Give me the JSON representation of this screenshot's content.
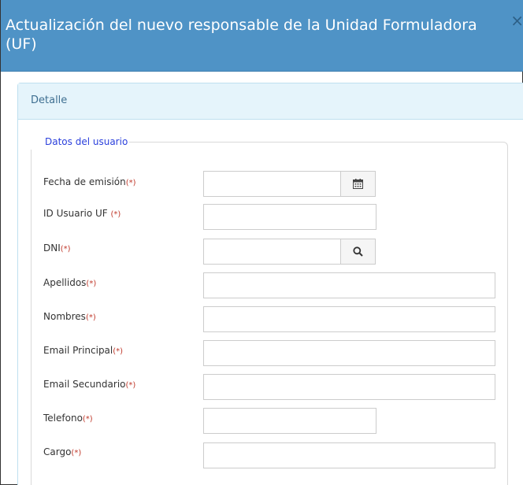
{
  "modal": {
    "title": "Actualización del nuevo responsable de la Unidad Formuladora (UF)",
    "close_icon": "×"
  },
  "panel": {
    "heading": "Detalle"
  },
  "fieldset": {
    "legend": "Datos del usuario"
  },
  "fields": {
    "fecha_emision": {
      "label": "Fecha de emisión",
      "required": "(*)",
      "value": "",
      "icon": "calendar-icon"
    },
    "id_usuario": {
      "label": "ID Usuario UF ",
      "required": "(*)",
      "value": ""
    },
    "dni": {
      "label": "DNI",
      "required": "(*)",
      "value": "",
      "icon": "search-icon"
    },
    "apellidos": {
      "label": "Apellidos",
      "required": "(*)",
      "value": ""
    },
    "nombres": {
      "label": "Nombres",
      "required": "(*)",
      "value": ""
    },
    "email_principal": {
      "label": "Email Principal",
      "required": "(*)",
      "value": ""
    },
    "email_secundario": {
      "label": "Email Secundario",
      "required": "(*)",
      "value": ""
    },
    "telefono": {
      "label": "Telefono",
      "required": "(*)",
      "value": ""
    },
    "cargo": {
      "label": "Cargo",
      "required": "(*)",
      "value": ""
    }
  },
  "colors": {
    "header": "#4f93c6",
    "panel_heading": "#e5f4fb",
    "required": "#c0392b",
    "legend": "#2a3fdc"
  }
}
